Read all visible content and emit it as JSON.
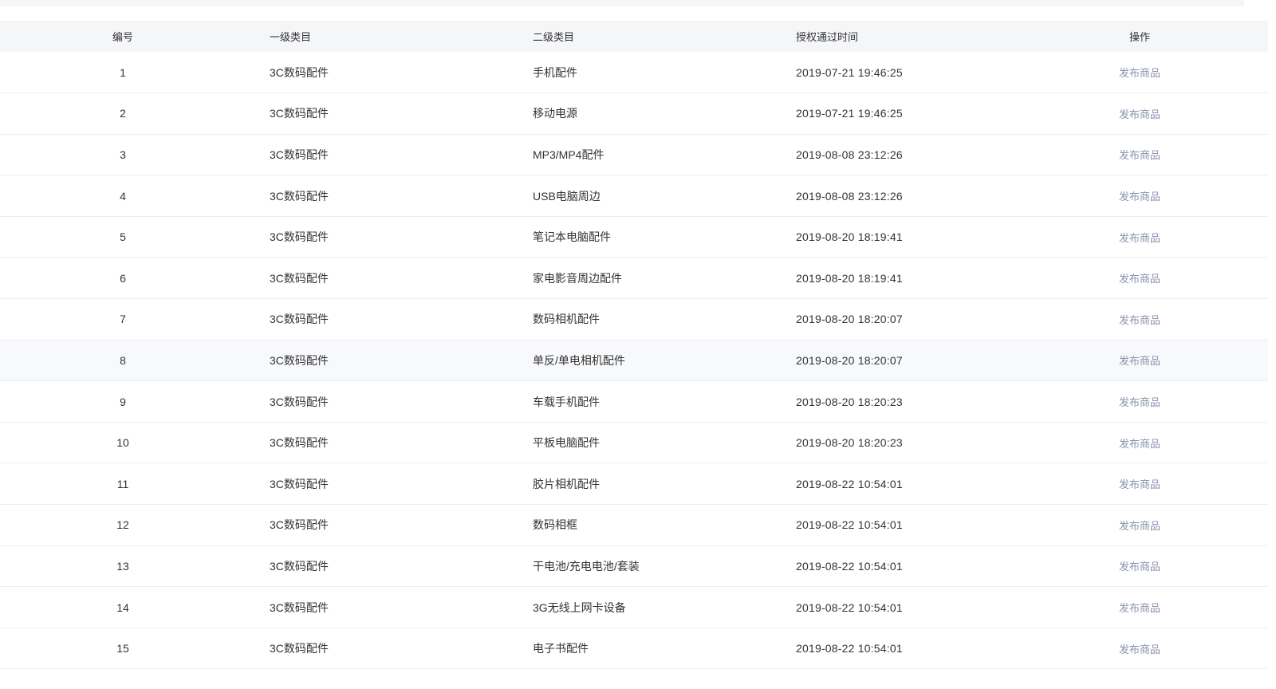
{
  "table": {
    "headers": {
      "num": "编号",
      "cat1": "一级类目",
      "cat2": "二级类目",
      "time": "授权通过时间",
      "op": "操作"
    },
    "rows": [
      {
        "num": "1",
        "cat1": "3C数码配件",
        "cat2": "手机配件",
        "time": "2019-07-21 19:46:25",
        "action": "发布商品"
      },
      {
        "num": "2",
        "cat1": "3C数码配件",
        "cat2": "移动电源",
        "time": "2019-07-21 19:46:25",
        "action": "发布商品"
      },
      {
        "num": "3",
        "cat1": "3C数码配件",
        "cat2": "MP3/MP4配件",
        "time": "2019-08-08 23:12:26",
        "action": "发布商品"
      },
      {
        "num": "4",
        "cat1": "3C数码配件",
        "cat2": "USB电脑周边",
        "time": "2019-08-08 23:12:26",
        "action": "发布商品"
      },
      {
        "num": "5",
        "cat1": "3C数码配件",
        "cat2": "笔记本电脑配件",
        "time": "2019-08-20 18:19:41",
        "action": "发布商品"
      },
      {
        "num": "6",
        "cat1": "3C数码配件",
        "cat2": "家电影音周边配件",
        "time": "2019-08-20 18:19:41",
        "action": "发布商品"
      },
      {
        "num": "7",
        "cat1": "3C数码配件",
        "cat2": "数码相机配件",
        "time": "2019-08-20 18:20:07",
        "action": "发布商品"
      },
      {
        "num": "8",
        "cat1": "3C数码配件",
        "cat2": "单反/单电相机配件",
        "time": "2019-08-20 18:20:07",
        "action": "发布商品"
      },
      {
        "num": "9",
        "cat1": "3C数码配件",
        "cat2": "车载手机配件",
        "time": "2019-08-20 18:20:23",
        "action": "发布商品"
      },
      {
        "num": "10",
        "cat1": "3C数码配件",
        "cat2": "平板电脑配件",
        "time": "2019-08-20 18:20:23",
        "action": "发布商品"
      },
      {
        "num": "11",
        "cat1": "3C数码配件",
        "cat2": "胶片相机配件",
        "time": "2019-08-22 10:54:01",
        "action": "发布商品"
      },
      {
        "num": "12",
        "cat1": "3C数码配件",
        "cat2": "数码相框",
        "time": "2019-08-22 10:54:01",
        "action": "发布商品"
      },
      {
        "num": "13",
        "cat1": "3C数码配件",
        "cat2": "干电池/充电电池/套装",
        "time": "2019-08-22 10:54:01",
        "action": "发布商品"
      },
      {
        "num": "14",
        "cat1": "3C数码配件",
        "cat2": "3G无线上网卡设备",
        "time": "2019-08-22 10:54:01",
        "action": "发布商品"
      },
      {
        "num": "15",
        "cat1": "3C数码配件",
        "cat2": "电子书配件",
        "time": "2019-08-22 10:54:01",
        "action": "发布商品"
      }
    ]
  },
  "colors": {
    "header_bg": "#f5f6f8",
    "link": "#8a93ad",
    "row_border": "#eceef2",
    "hover_row_bg": "#f8f9fb"
  }
}
